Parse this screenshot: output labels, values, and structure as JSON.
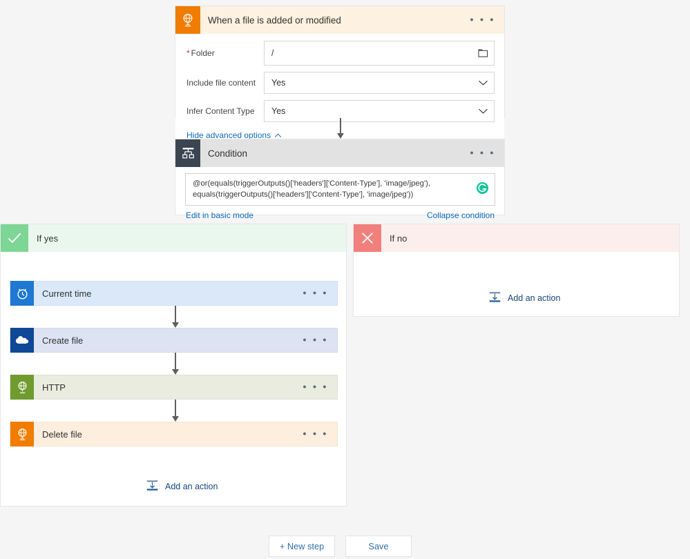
{
  "page": {
    "background": "#f5f5f5"
  },
  "trigger": {
    "title": "When a file is added or modified",
    "icon": "ftp-globe-icon",
    "icon_color": "#f07c00",
    "header_background": "#fdf1e1",
    "more_label": "• • •",
    "fields": [
      {
        "label": "Folder",
        "required": true,
        "value": "/",
        "placeholder": "",
        "trailing_icon": "folder-picker-icon"
      },
      {
        "label": "Include file content",
        "required": false,
        "value": "Yes",
        "placeholder": "",
        "trailing_icon": "chevron-down-icon"
      },
      {
        "label": "Infer Content Type",
        "required": false,
        "value": "Yes",
        "placeholder": "",
        "trailing_icon": "chevron-down-icon"
      }
    ],
    "advanced_link": "Hide advanced options",
    "advanced_link_icon": "chevron-up-icon"
  },
  "condition": {
    "title": "Condition",
    "icon": "condition-branch-icon",
    "icon_color": "#3b4552",
    "header_background": "#e2e2e2",
    "more_label": "• • •",
    "expression": "@or(equals(triggerOutputs()['headers']['Content-Type'], 'image/jpeg'), equals(triggerOutputs()['headers']['Content-Type'], 'image/jpeg'))",
    "grammarly_icon": "grammarly-icon",
    "grammarly_color": "#15c39a",
    "basic_mode_link": "Edit in basic mode",
    "collapse_link": "Collapse condition"
  },
  "branches": {
    "yes": {
      "label": "If yes",
      "badge_icon": "checkmark-icon",
      "badge_color": "#7ed696",
      "header_background": "#eaf7ef",
      "actions": [
        {
          "title": "Current time",
          "icon": "alarm-clock-icon",
          "icon_color": "#1f78d1",
          "body_color": "#dae8fa",
          "more_label": "• • •"
        },
        {
          "title": "Create file",
          "icon": "onedrive-cloud-icon",
          "icon_color": "#0f4896",
          "body_color": "#dde3f3",
          "more_label": "• • •"
        },
        {
          "title": "HTTP",
          "icon": "http-globe-icon",
          "icon_color": "#6f9b2f",
          "body_color": "#e9ecdf",
          "more_label": "• • •"
        },
        {
          "title": "Delete file",
          "icon": "ftp-globe-icon",
          "icon_color": "#f07c00",
          "body_color": "#fdeedd",
          "more_label": "• • •"
        }
      ],
      "add_action_label": "Add an action",
      "add_action_icon": "insert-step-icon"
    },
    "no": {
      "label": "If no",
      "badge_icon": "close-x-icon",
      "badge_color": "#f1807c",
      "header_background": "#fdeeee",
      "actions": [],
      "add_action_label": "Add an action",
      "add_action_icon": "insert-step-icon"
    }
  },
  "footer": {
    "new_step_label": "+ New step",
    "save_label": "Save"
  }
}
